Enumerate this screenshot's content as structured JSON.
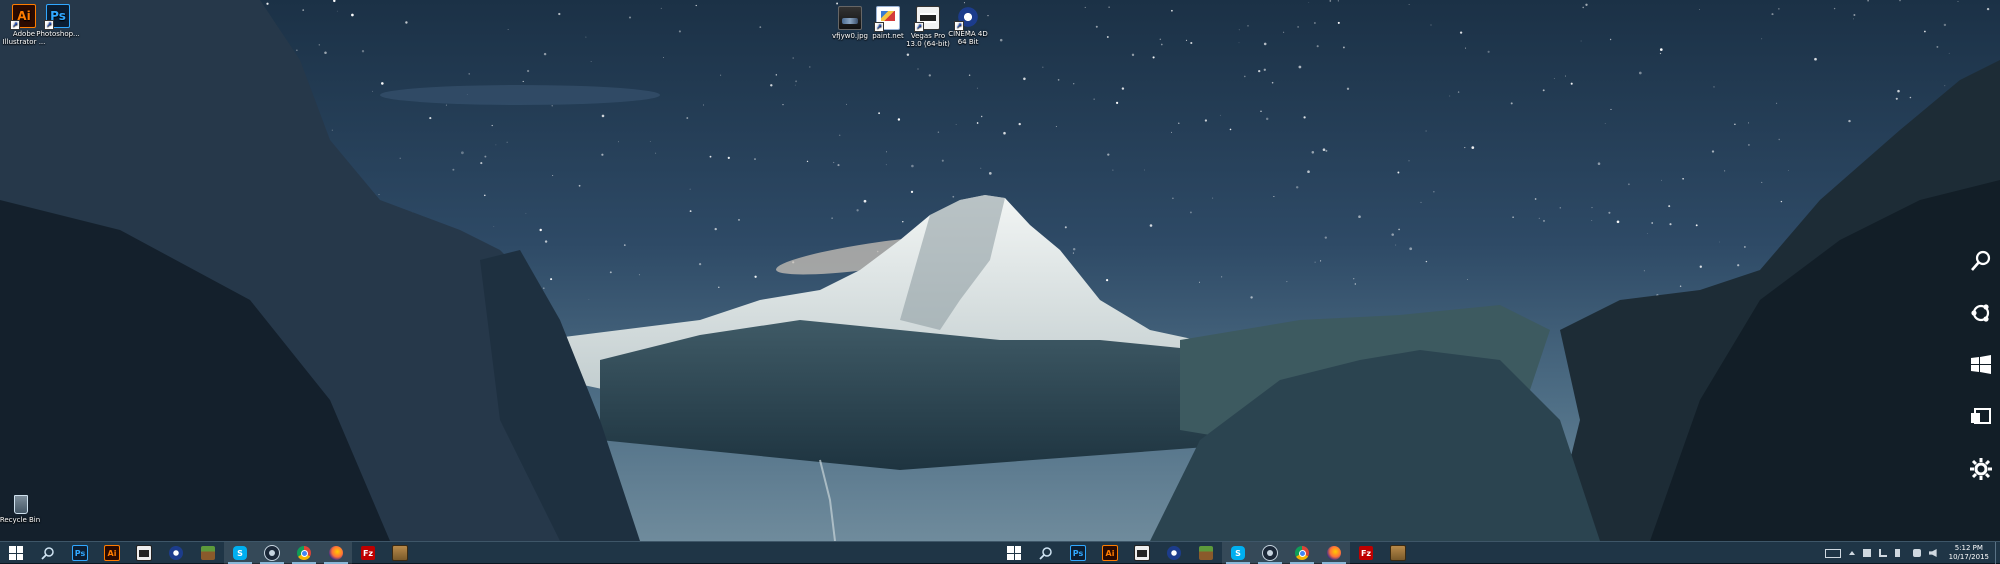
{
  "desktop": {
    "left_icons": [
      {
        "icon": "adobe-illustrator-icon",
        "label": "Adobe\nIllustrator ...",
        "glyph": "Ai"
      },
      {
        "icon": "photoshop-icon",
        "label": "Photoshop...",
        "glyph": "Ps"
      }
    ],
    "center_icons": [
      {
        "icon": "image-file-icon",
        "label": "vfjyw0.jpg"
      },
      {
        "icon": "paint-net-icon",
        "label": "paint.net"
      },
      {
        "icon": "vegas-pro-icon",
        "label": "Vegas Pro\n13.0 (64-bit)"
      },
      {
        "icon": "cinema-4d-icon",
        "label": "CINEMA 4D\n64 Bit"
      }
    ],
    "recycle_bin": {
      "icon": "recycle-bin-icon",
      "label": "Recycle Bin"
    }
  },
  "charms": [
    "search-icon",
    "share-icon",
    "start-icon",
    "devices-icon",
    "settings-icon"
  ],
  "taskbar": {
    "left_group": [
      "windows-start-icon",
      "search-icon",
      "photoshop-icon",
      "illustrator-icon",
      "vegas-pro-icon",
      "cinema-4d-icon",
      "minecraft-icon",
      "skype-icon",
      "steam-icon",
      "chrome-icon",
      "firefox-icon",
      "filezilla-icon",
      "package-icon"
    ],
    "right_group": [
      "windows-start-icon",
      "search-icon",
      "photoshop-icon",
      "illustrator-icon",
      "vegas-pro-icon",
      "cinema-4d-icon",
      "minecraft-icon",
      "skype-icon",
      "steam-icon",
      "chrome-icon",
      "firefox-icon",
      "filezilla-icon",
      "package-icon"
    ],
    "ps_glyph": "Ps",
    "ai_glyph": "Ai",
    "skype_glyph": "S",
    "filezilla_glyph": "Fz",
    "clock": {
      "time": "5:12 PM",
      "date": "10/17/2015"
    }
  },
  "colors": {
    "taskbar": "#1f3546",
    "sky": "#2e4a66",
    "snow": "#dfe6e6"
  }
}
